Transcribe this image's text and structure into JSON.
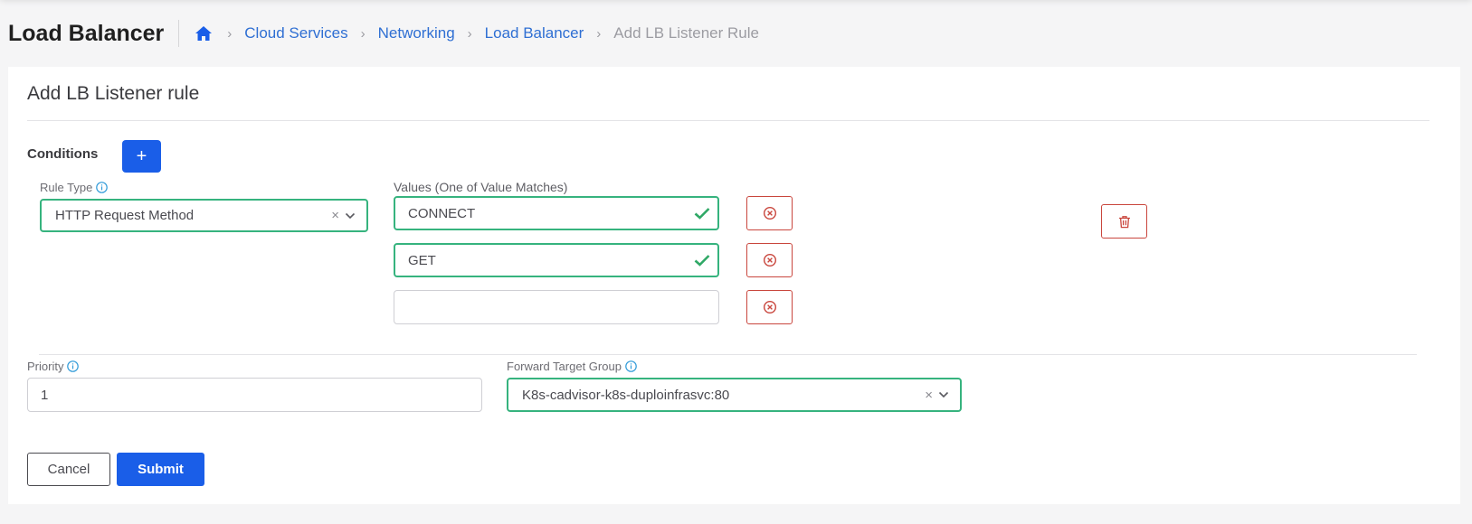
{
  "header": {
    "title": "Load Balancer",
    "breadcrumb": {
      "home_icon": "home-icon",
      "items": [
        "Cloud Services",
        "Networking",
        "Load Balancer"
      ],
      "current": "Add LB Listener Rule"
    }
  },
  "form": {
    "title": "Add LB Listener rule",
    "conditions": {
      "label": "Conditions",
      "add_label": "+",
      "rule_type": {
        "label": "Rule Type",
        "value": "HTTP Request Method",
        "clear": "×"
      },
      "values": {
        "label": "Values (One of Value Matches)",
        "items": [
          "CONNECT",
          "GET",
          ""
        ]
      }
    },
    "priority": {
      "label": "Priority",
      "value": "1"
    },
    "target_group": {
      "label": "Forward Target Group",
      "value": "K8s-cadvisor-k8s-duploinfrasvc:80",
      "clear": "×"
    },
    "actions": {
      "cancel": "Cancel",
      "submit": "Submit"
    }
  },
  "colors": {
    "primary": "#1a5ee8",
    "success": "#36b37e",
    "danger": "#c9463d",
    "link": "#2f6fd3"
  }
}
